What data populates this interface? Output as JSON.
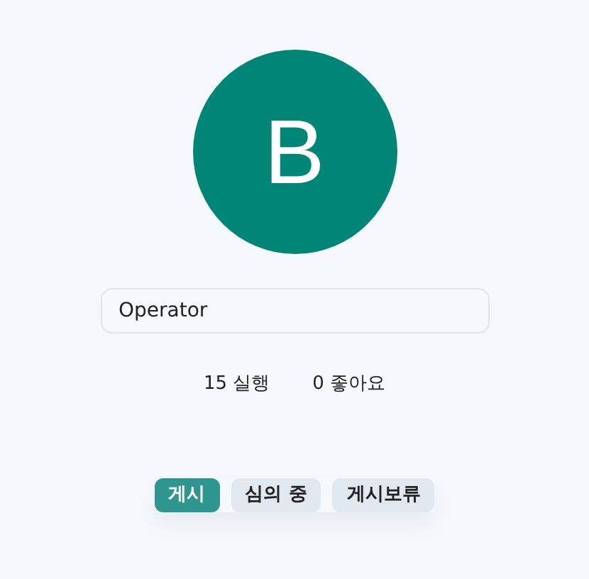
{
  "avatar": {
    "initial": "B"
  },
  "name_field": {
    "value": "Operator"
  },
  "stats": [
    "15 실행",
    "0 좋아요"
  ],
  "tabs": [
    {
      "label": "게시",
      "selected": true
    },
    {
      "label": "심의 중",
      "selected": false
    },
    {
      "label": "게시보류",
      "selected": false
    }
  ]
}
